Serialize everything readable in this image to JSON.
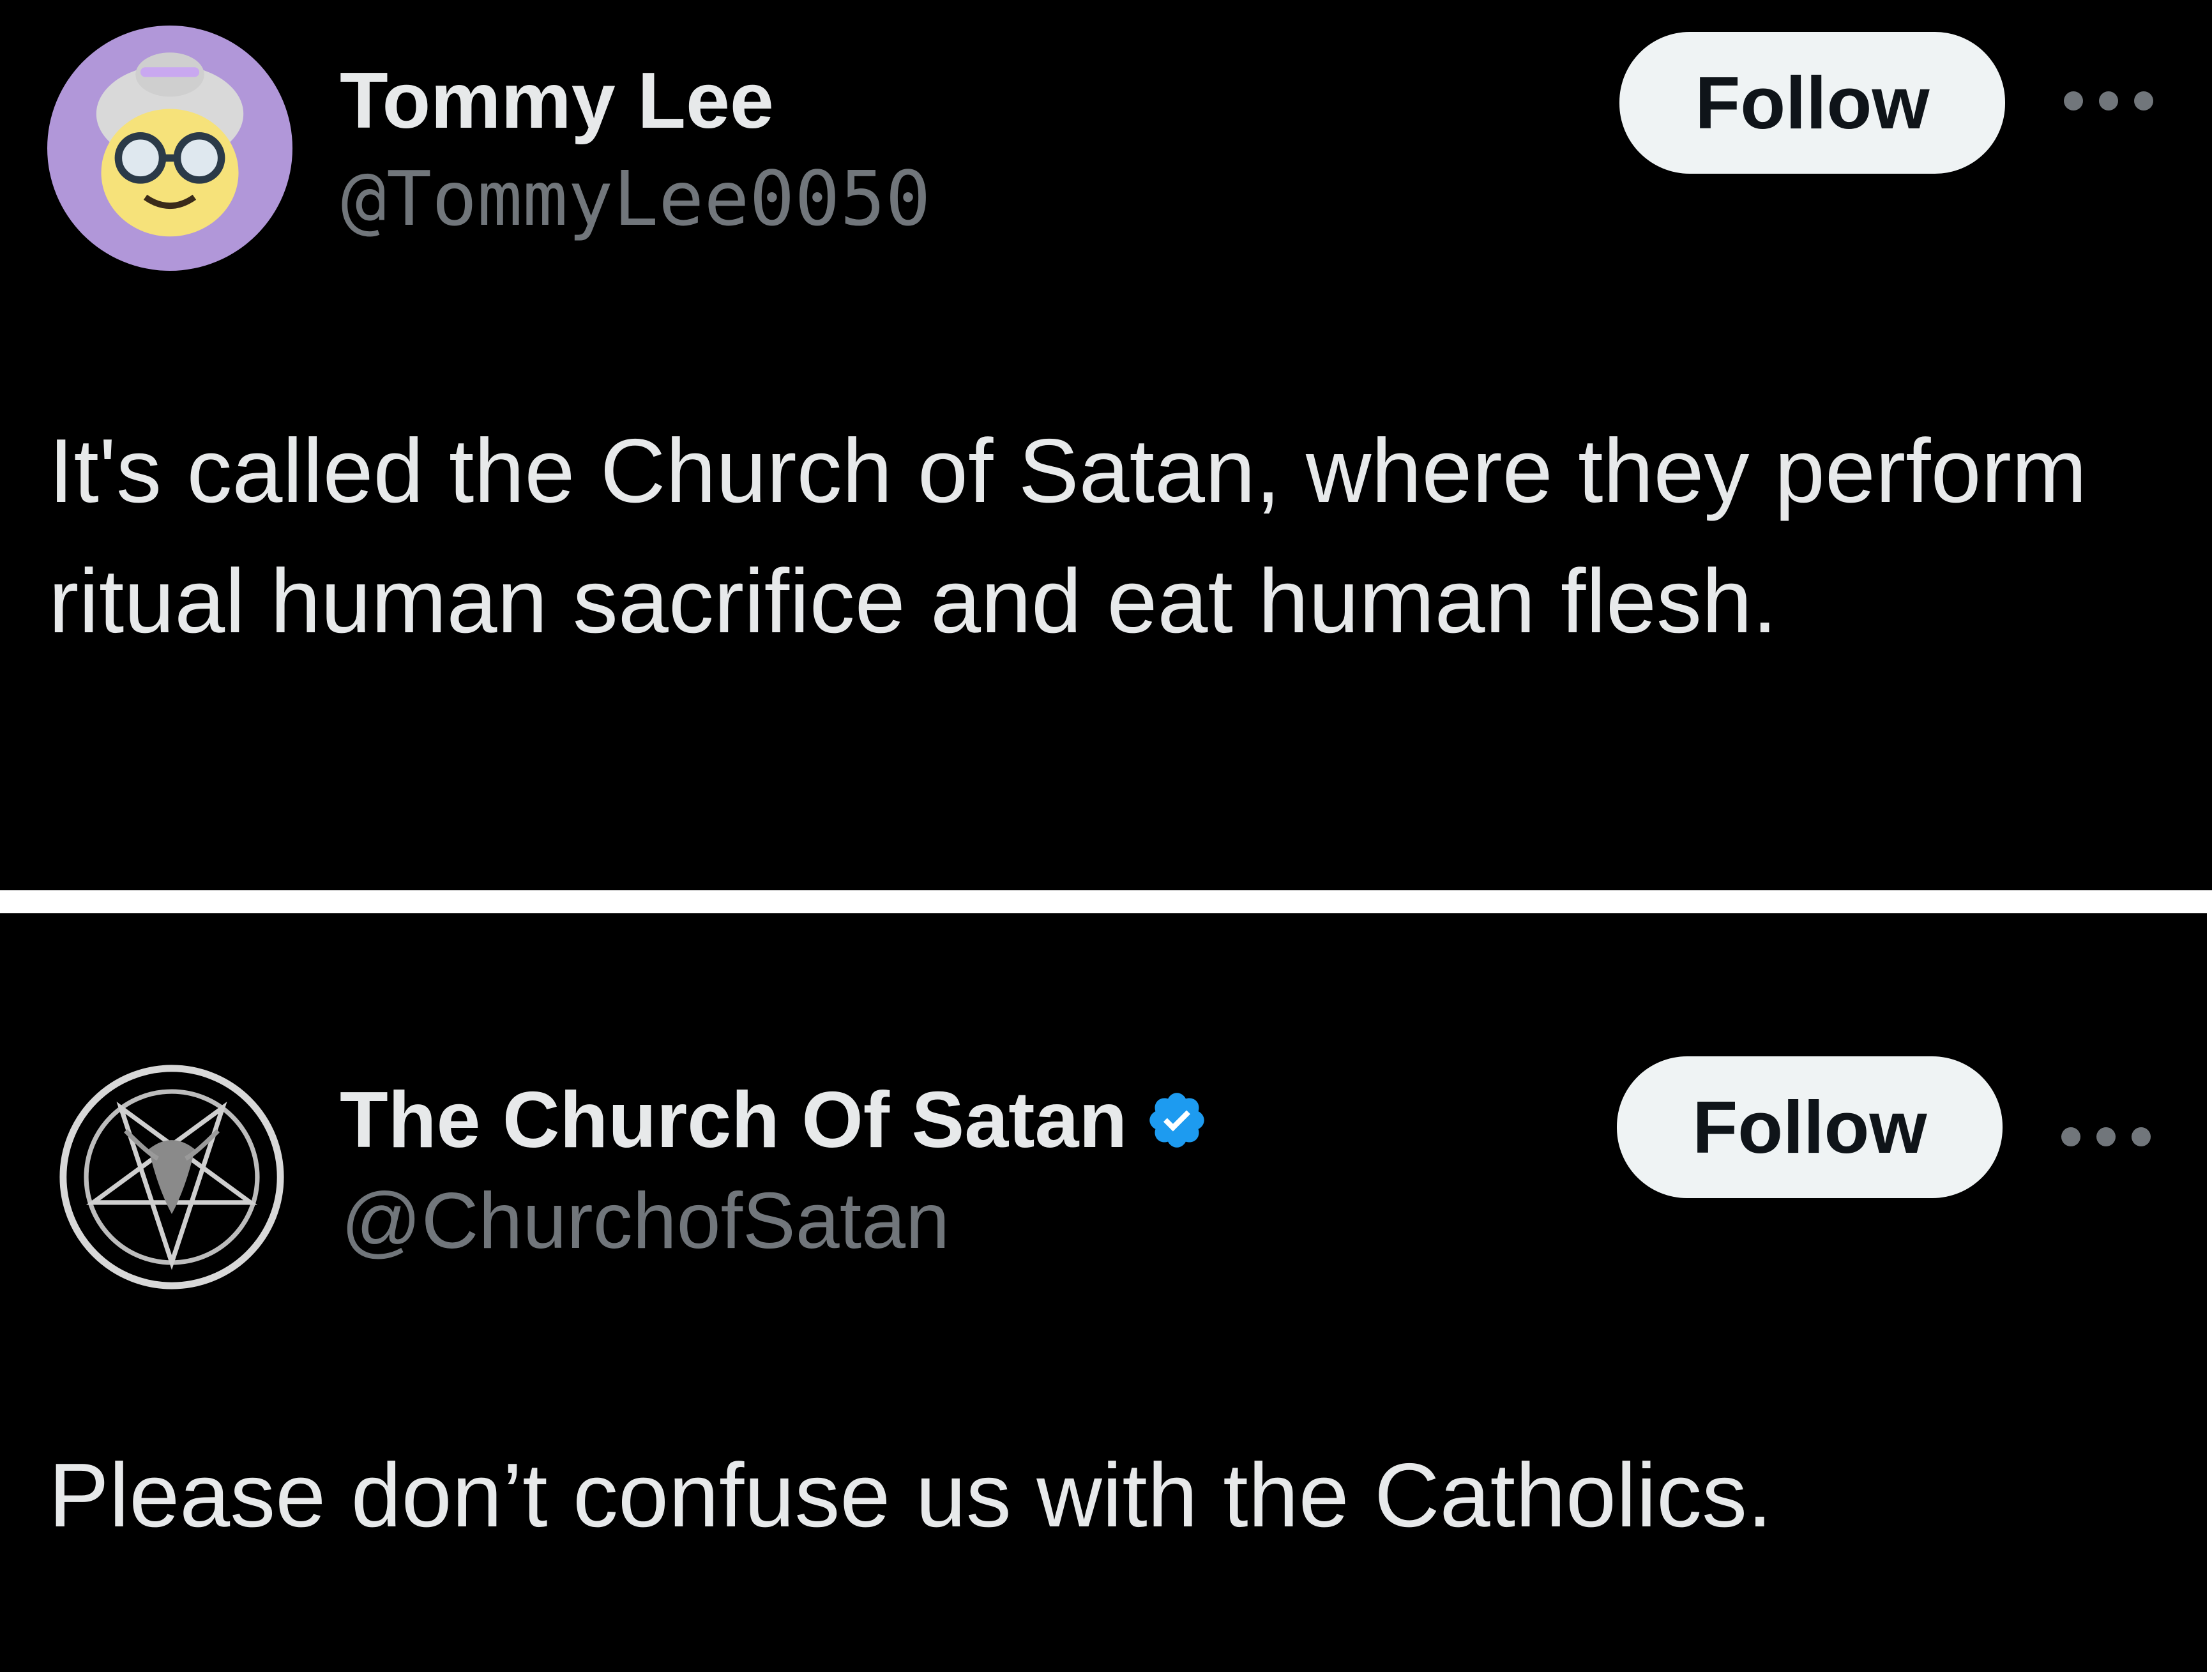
{
  "tweets": [
    {
      "author": {
        "display_name": "Tommy Lee",
        "handle": "@TommyLee0050",
        "avatar": "grandma-emoji-avatar",
        "verified": false
      },
      "follow_label": "Follow",
      "more_icon": "more-horizontal-icon",
      "text": "It's called the Church of Satan, where they perform ritual human sacrifice and eat human flesh."
    },
    {
      "author": {
        "display_name": "The Church Of Satan",
        "handle": "@ChurchofSatan",
        "avatar": "sigil-of-baphomet-avatar",
        "verified": true,
        "verified_badge_color": "#1d9bf0"
      },
      "follow_label": "Follow",
      "more_icon": "more-horizontal-icon",
      "text": "Please don’t confuse us with the Catholics."
    }
  ],
  "colors": {
    "background": "#000000",
    "divider": "#ffffff",
    "primary_text": "#e7e9ea",
    "secondary_text": "#71767b",
    "follow_bg": "#eff3f4",
    "follow_text": "#0f1419"
  }
}
